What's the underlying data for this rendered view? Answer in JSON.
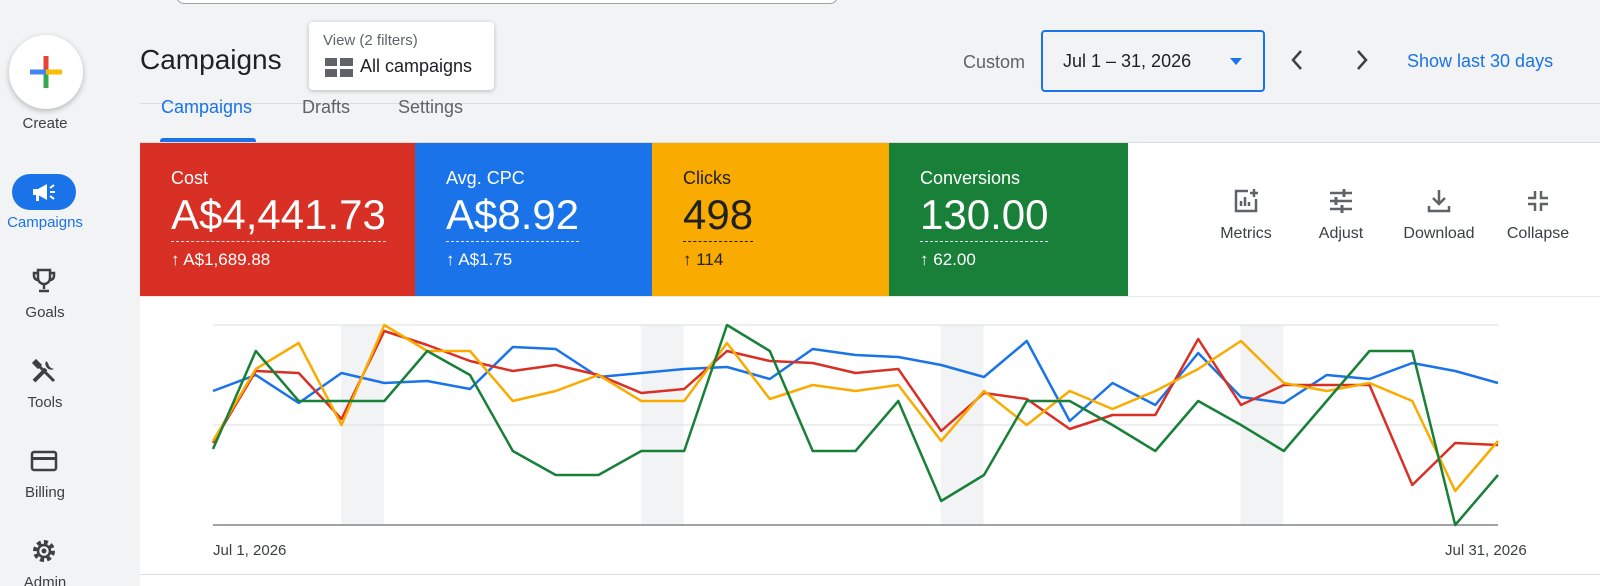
{
  "nav": {
    "create_label": "Create",
    "items": [
      {
        "label": "Campaigns",
        "icon": "campaigns-megaphone-icon",
        "active": true
      },
      {
        "label": "Goals",
        "icon": "trophy-icon"
      },
      {
        "label": "Tools",
        "icon": "tools-icon"
      },
      {
        "label": "Billing",
        "icon": "credit-card-icon"
      },
      {
        "label": "Admin",
        "icon": "gear-icon"
      }
    ]
  },
  "header": {
    "title": "Campaigns",
    "view_chip": {
      "sub": "View (2 filters)",
      "main": "All campaigns"
    },
    "date_range_label": "Custom",
    "date_range_value": "Jul 1 – 31, 2026",
    "show_last": "Show last 30 days"
  },
  "tabs": [
    {
      "label": "Campaigns",
      "active": true
    },
    {
      "label": "Drafts"
    },
    {
      "label": "Settings"
    }
  ],
  "metrics": [
    {
      "title": "Cost",
      "value": "A$4,441.73",
      "delta": "A$1,689.88",
      "color": "#d93025"
    },
    {
      "title": "Avg. CPC",
      "value": "A$8.92",
      "delta": "A$1.75",
      "color": "#1a73e8"
    },
    {
      "title": "Clicks",
      "value": "498",
      "delta": "114",
      "color": "#f9ab00"
    },
    {
      "title": "Conversions",
      "value": "130.00",
      "delta": "62.00",
      "color": "#188038"
    }
  ],
  "tools": [
    {
      "label": "Metrics",
      "icon": "metrics-chart-add-icon"
    },
    {
      "label": "Adjust",
      "icon": "adjust-sliders-icon"
    },
    {
      "label": "Download",
      "icon": "download-icon"
    },
    {
      "label": "Collapse",
      "icon": "collapse-icon"
    }
  ],
  "chart_data": {
    "type": "line",
    "x_start_label": "Jul 1, 2026",
    "x_end_label": "Jul 31, 2026",
    "ylim": [
      0,
      100
    ],
    "grid": true,
    "weekend_bands": [
      3,
      10,
      17,
      24
    ],
    "series": [
      {
        "color": "#1a73e8",
        "values": [
          67,
          75,
          61,
          76,
          71,
          72,
          68,
          89,
          88,
          74,
          76,
          78,
          79,
          73,
          88,
          85,
          84,
          80,
          74,
          92,
          52,
          71,
          60,
          86,
          64,
          61,
          75,
          73,
          81,
          77,
          71
        ]
      },
      {
        "color": "#d93025",
        "values": [
          41,
          77,
          76,
          53,
          97,
          90,
          82,
          77,
          80,
          75,
          66,
          68,
          87,
          82,
          81,
          76,
          78,
          47,
          66,
          63,
          48,
          55,
          55,
          93,
          60,
          70,
          70,
          70,
          20,
          41,
          40
        ]
      },
      {
        "color": "#f9ab00",
        "values": [
          42,
          78,
          91,
          50,
          100,
          87,
          87,
          62,
          67,
          75,
          62,
          62,
          91,
          63,
          70,
          67,
          70,
          42,
          67,
          50,
          67,
          58,
          67,
          78,
          92,
          71,
          67,
          71,
          62,
          17,
          42,
          41
        ]
      },
      {
        "color": "#188038",
        "values": [
          38,
          87,
          62,
          62,
          62,
          87,
          75,
          37,
          25,
          25,
          37,
          37,
          100,
          87,
          37,
          37,
          62,
          12,
          25,
          62,
          62,
          50,
          37,
          62,
          50,
          37,
          62,
          87,
          87,
          0,
          25,
          25
        ]
      }
    ]
  }
}
